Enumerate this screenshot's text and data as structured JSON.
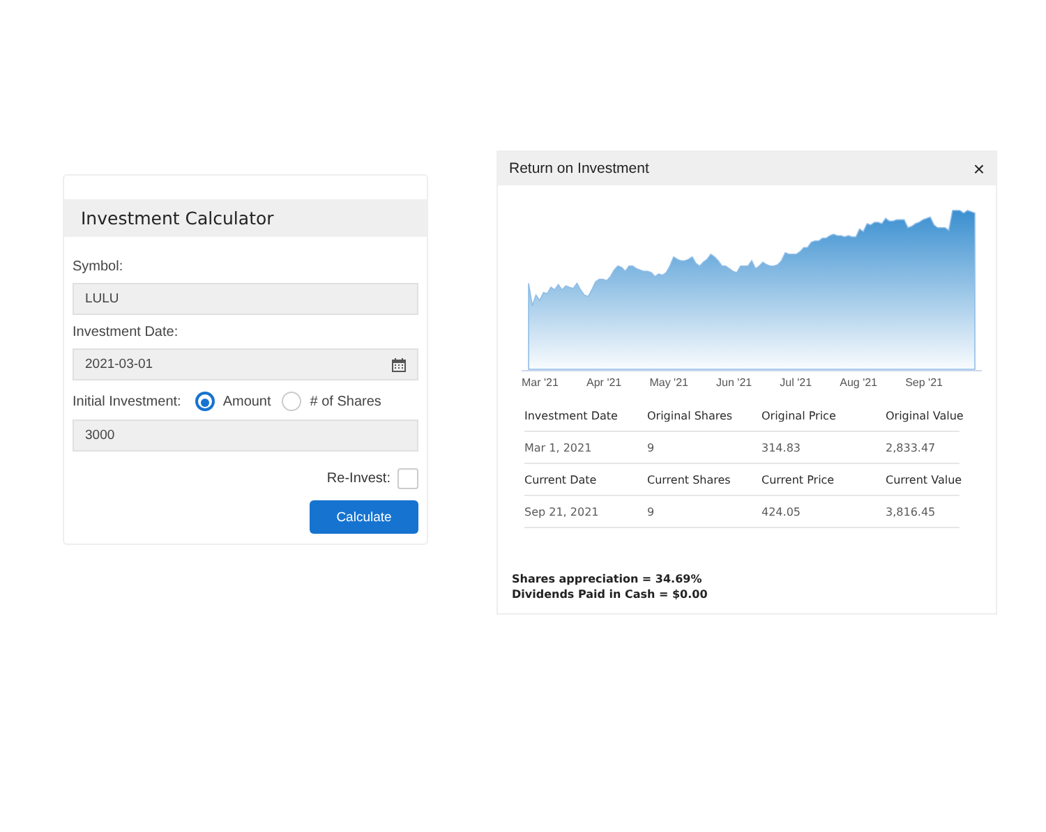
{
  "calculator": {
    "title": "Investment Calculator",
    "fields": [
      {
        "kind": "text",
        "label": "Symbol:",
        "value": "LULU"
      },
      {
        "kind": "date",
        "label": "Investment Date:",
        "value": "2021-03-01"
      },
      {
        "kind": "radio",
        "label": "Initial Investment:",
        "options": [
          {
            "label": "Amount",
            "selected": true
          },
          {
            "label": "# of Shares",
            "selected": false
          }
        ],
        "value": "3000"
      }
    ],
    "reinvest": {
      "label": "Re-Invest:",
      "checked": false
    },
    "button": "Calculate"
  },
  "result": {
    "title": "Return on Investment",
    "close": "×",
    "chart": {
      "axis_labels": [
        "Mar '21",
        "Apr '21",
        "May '21",
        "Jun '21",
        "Jul '21",
        "Aug '21",
        "Sep '21"
      ]
    },
    "table": [
      {
        "kind": "header",
        "cells": [
          "Investment Date",
          "Original Shares",
          "Original Price",
          "Original Value"
        ]
      },
      {
        "kind": "data",
        "cells": [
          "Mar 1, 2021",
          "9",
          "314.83",
          "2,833.47"
        ]
      },
      {
        "kind": "header",
        "cells": [
          "Current Date",
          "Current Shares",
          "Current Price",
          "Current Value"
        ]
      },
      {
        "kind": "data",
        "cells": [
          "Sep 21, 2021",
          "9",
          "424.05",
          "3,816.45"
        ]
      }
    ],
    "summary": [
      "Shares appreciation = 34.69%",
      "Dividends Paid in Cash = $0.00"
    ]
  }
}
